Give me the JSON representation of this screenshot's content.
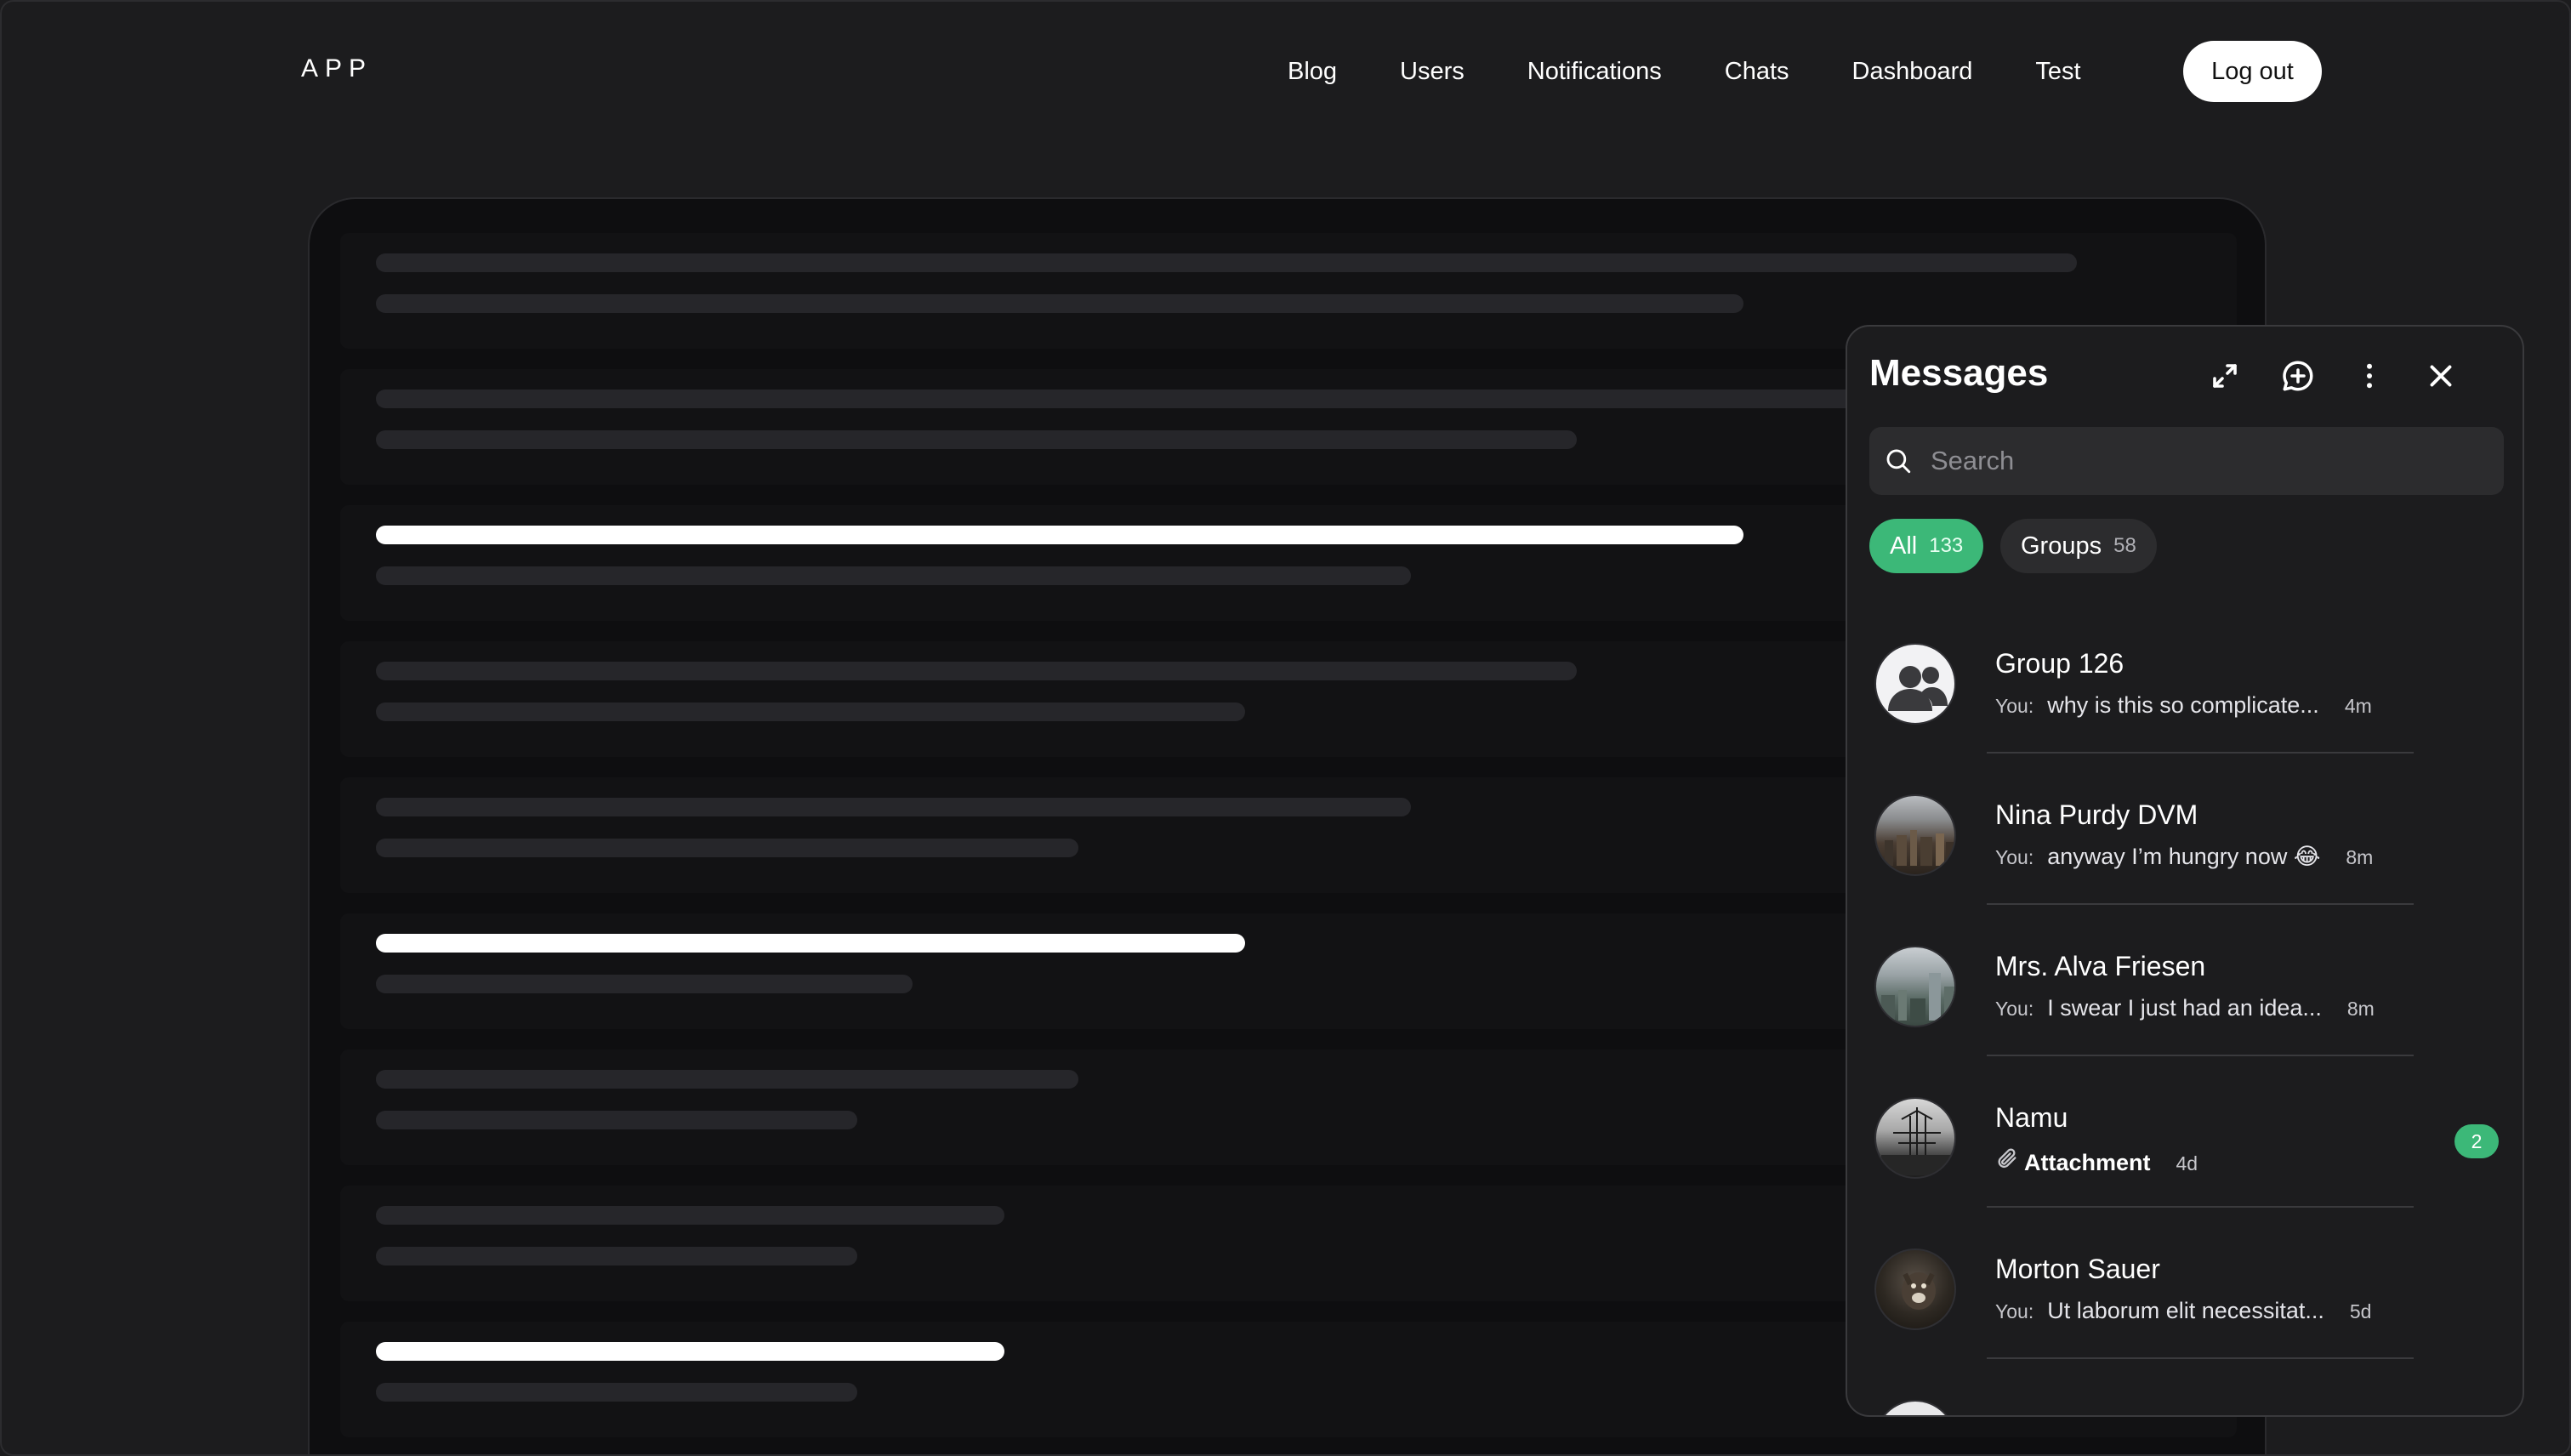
{
  "app": {
    "logo": "APP"
  },
  "nav": {
    "links": [
      "Blog",
      "Users",
      "Notifications",
      "Chats",
      "Dashboard",
      "Test"
    ],
    "logout_label": "Log out"
  },
  "messages": {
    "title": "Messages",
    "search_placeholder": "Search",
    "filters": [
      {
        "label": "All",
        "count": "133",
        "active": true
      },
      {
        "label": "Groups",
        "count": "58",
        "active": false
      }
    ],
    "you_prefix": "You:",
    "conversations": [
      {
        "name": "Group 126",
        "from_you": true,
        "preview": "why is this so complicate...",
        "time": "4m",
        "avatar": "group-icon"
      },
      {
        "name": "Nina Purdy DVM",
        "from_you": true,
        "preview": "anyway I’m hungry now 😂",
        "time": "8m",
        "avatar": "city-photo"
      },
      {
        "name": "Mrs. Alva Friesen",
        "from_you": true,
        "preview": "I swear I just had an idea...",
        "time": "8m",
        "avatar": "skyline-photo"
      },
      {
        "name": "Namu",
        "from_you": false,
        "preview": "Attachment",
        "time": "4d",
        "avatar": "harbor-photo",
        "unread": "2",
        "attachment": true
      },
      {
        "name": "Morton Sauer",
        "from_you": true,
        "preview": "Ut laborum elit necessitat...",
        "time": "5d",
        "avatar": "dog-photo"
      }
    ]
  },
  "colors": {
    "background": "#1c1c1e",
    "accent": "#3cb878",
    "card": "#0e0e10"
  }
}
